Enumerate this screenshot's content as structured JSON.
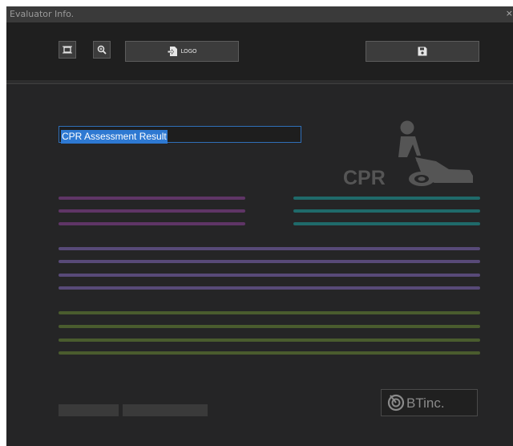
{
  "window": {
    "title": "Evaluator Info.",
    "close_glyph": "×"
  },
  "toolbar": {
    "logo_label": "LOGO",
    "fit_icon": "fit-screen-icon",
    "zoom_icon": "zoom-icon",
    "import_icon": "import-icon",
    "save_icon": "save-icon"
  },
  "report": {
    "title_value": "CPR Assessment Result",
    "cpr_badge": "CPR",
    "company_logo": "BTinc."
  },
  "colors": {
    "accent_blue": "#2e79d2",
    "purple": "#5f3566",
    "teal": "#1f6a6a",
    "violet": "#584a78",
    "olive": "#4a5c2e"
  }
}
